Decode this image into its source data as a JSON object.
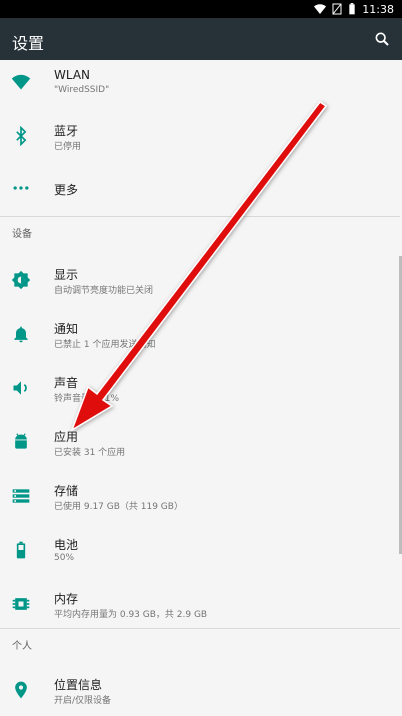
{
  "status": {
    "time": "11:38"
  },
  "header": {
    "title": "设置",
    "search_icon": "search-icon"
  },
  "items": [
    {
      "label": "WLAN",
      "sub": "\"WiredSSID\"",
      "icon": "wifi-icon"
    },
    {
      "label": "蓝牙",
      "sub": "已停用",
      "icon": "bluetooth-icon"
    },
    {
      "label": "更多",
      "sub": "",
      "icon": "more-horiz-icon"
    }
  ],
  "section_device": {
    "title": "设备"
  },
  "device_items": [
    {
      "label": "显示",
      "sub": "自动调节亮度功能已关闭",
      "icon": "brightness-icon"
    },
    {
      "label": "通知",
      "sub": "已禁止 1 个应用发送通知",
      "icon": "bell-icon"
    },
    {
      "label": "声音",
      "sub": "铃声音量：71%",
      "icon": "volume-icon"
    },
    {
      "label": "应用",
      "sub": "已安装 31 个应用",
      "icon": "android-icon"
    },
    {
      "label": "存储",
      "sub": "已使用 9.17 GB（共 119 GB）",
      "icon": "storage-icon"
    },
    {
      "label": "电池",
      "sub": "50%",
      "icon": "battery-icon"
    },
    {
      "label": "内存",
      "sub": "平均内存用量为 0.93 GB，共 2.9 GB",
      "icon": "memory-icon"
    }
  ],
  "section_personal": {
    "title": "个人"
  },
  "personal_items": [
    {
      "label": "位置信息",
      "sub": "开启/仅限设备",
      "icon": "location-icon"
    }
  ],
  "colors": {
    "accent": "#009688",
    "appbar": "#263238",
    "arrow": "#e01010"
  }
}
